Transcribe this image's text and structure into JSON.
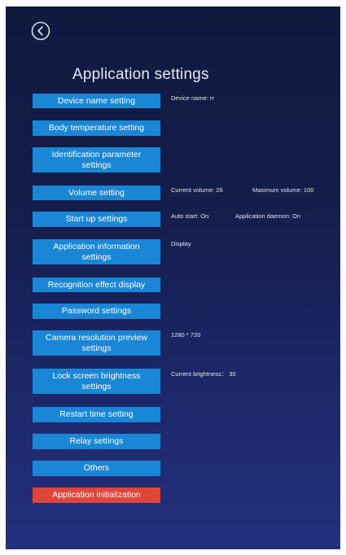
{
  "header": {
    "back_icon": "circle-chevron-left-icon",
    "title": "Application settings"
  },
  "colors": {
    "button_primary": "#1a86d6",
    "button_danger": "#e0453a",
    "background_top": "#101a3e",
    "background_bottom": "#24307e"
  },
  "settings": {
    "device_name": {
      "label": "Device name setting",
      "info": "Device name: rr"
    },
    "body_temperature": {
      "label": "Body temperature setting"
    },
    "identification_parameter": {
      "label": "Identification parameter settings"
    },
    "volume": {
      "label": "Volume setting",
      "current": "Current volume: 26",
      "maximum": "Maximum volume: 100"
    },
    "start_up": {
      "label": "Start up settings",
      "auto_start": "Auto start: On",
      "daemon": "Application  daemon: On"
    },
    "application_information": {
      "label": "Application information settings",
      "info": "Display"
    },
    "recognition_effect": {
      "label": "Recognition effect display"
    },
    "password": {
      "label": "Password settings"
    },
    "camera_resolution": {
      "label": "Camera resolution preview settings",
      "info": "1280 * 720"
    },
    "lock_screen_brightness": {
      "label": "Lock screen brightness settings",
      "info": "Current brightness： 30"
    },
    "restart_time": {
      "label": "Restart time setting"
    },
    "relay": {
      "label": "Relay settings"
    },
    "others": {
      "label": "Others"
    },
    "application_initialization": {
      "label": "Application initialization"
    }
  }
}
